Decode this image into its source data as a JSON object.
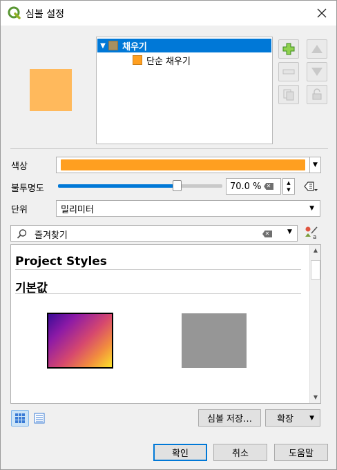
{
  "window": {
    "title": "심볼 설정",
    "close_icon": "close-icon"
  },
  "preview": {
    "color": "#ffb95c"
  },
  "layer_tree": {
    "items": [
      {
        "label": "채우기",
        "swatch": "#a89060",
        "selected": true,
        "expanded": true
      },
      {
        "label": "단순 채우기",
        "swatch": "#ff9f20",
        "selected": false
      }
    ]
  },
  "side_buttons": {
    "add": "plus-icon",
    "remove": "minus-icon",
    "up": "arrow-up-icon",
    "down": "arrow-down-icon",
    "duplicate": "duplicate-icon",
    "lock": "lock-icon"
  },
  "properties": {
    "color_label": "색상",
    "color_value": "#ff9f20",
    "opacity_label": "불투명도",
    "opacity_value": "70.0 %",
    "opacity_fraction": 0.7,
    "unit_label": "단위",
    "unit_value": "밀리미터"
  },
  "library": {
    "search_placeholder": "즐겨찾기",
    "groups": [
      {
        "title": "Project Styles"
      },
      {
        "title": "기본값"
      }
    ],
    "symbols": [
      {
        "kind": "gradient",
        "colors": [
          "#3b0c97",
          "#d6486e",
          "#fbe22a"
        ],
        "selected": true
      },
      {
        "kind": "solid",
        "color": "#969696",
        "selected": false
      }
    ]
  },
  "bottom": {
    "save_symbol": "심볼 저장…",
    "advanced": "확장",
    "ok": "확인",
    "cancel": "취소",
    "help": "도움말"
  }
}
